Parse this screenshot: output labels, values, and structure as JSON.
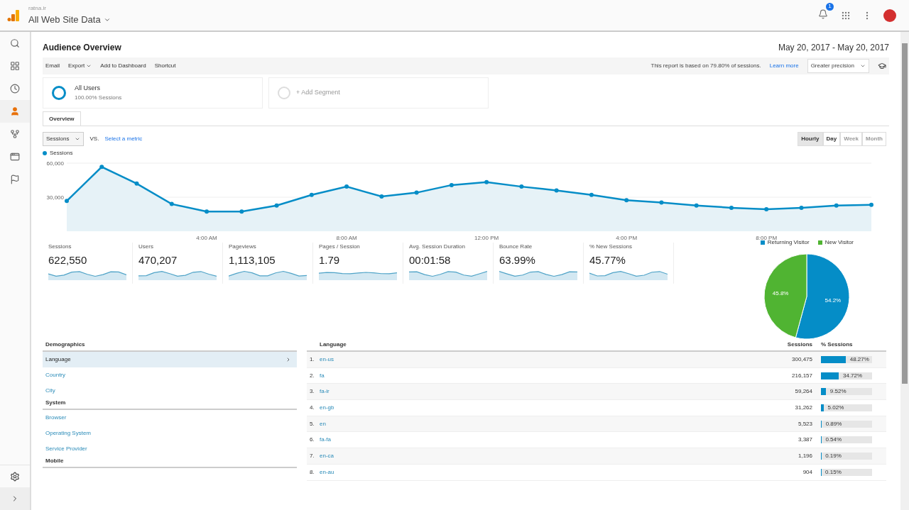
{
  "header": {
    "account": "ratna.ir",
    "property": "All Web Site Data",
    "notification_count": "1"
  },
  "sidebar": {
    "items": [
      {
        "kind": "search",
        "selected": false
      },
      {
        "kind": "dashboard",
        "selected": false
      },
      {
        "kind": "clock",
        "selected": false
      },
      {
        "kind": "person",
        "selected": true
      },
      {
        "kind": "fork",
        "selected": false
      },
      {
        "kind": "window",
        "selected": false
      },
      {
        "kind": "flag",
        "selected": false
      }
    ]
  },
  "page": {
    "title": "Audience Overview",
    "date_range": "May 20, 2017 - May 20, 2017"
  },
  "toolbar": {
    "actions": [
      {
        "label": "Email",
        "dropdown": false
      },
      {
        "label": "Export",
        "dropdown": true
      },
      {
        "label": "Add to Dashboard",
        "dropdown": false
      },
      {
        "label": "Shortcut",
        "dropdown": false
      }
    ],
    "notice": "This report is based on 79.80% of sessions.",
    "learn_more": "Learn more",
    "precision": "Greater precision"
  },
  "segments": [
    {
      "kind": "active",
      "name": "All Users",
      "detail": "100.00% Sessions"
    },
    {
      "kind": "add",
      "name": "+ Add Segment"
    }
  ],
  "tabs": [
    {
      "label": "Overview",
      "selected": true
    }
  ],
  "chart_controls": {
    "metric": "Sessions",
    "vs": "VS.",
    "select_metric": "Select a metric",
    "intervals": [
      {
        "label": "Hourly",
        "selected": true,
        "disabled": false
      },
      {
        "label": "Day",
        "selected": false,
        "disabled": false
      },
      {
        "label": "Week",
        "selected": false,
        "disabled": true
      },
      {
        "label": "Month",
        "selected": false,
        "disabled": true
      }
    ]
  },
  "line_chart": {
    "chart_data": {
      "type": "area",
      "x": [
        0,
        1,
        2,
        3,
        4,
        5,
        6,
        7,
        8,
        9,
        10,
        11,
        12,
        13,
        14,
        15,
        16,
        17,
        18,
        19,
        20,
        21,
        22,
        23
      ],
      "series": [
        {
          "name": "Sessions",
          "color": "#058dc7",
          "values": [
            26700,
            56700,
            42000,
            24000,
            17300,
            17300,
            22700,
            32000,
            39300,
            30700,
            34000,
            40700,
            43300,
            39300,
            36000,
            32000,
            27300,
            25300,
            22700,
            20700,
            19300,
            20700,
            22700,
            23300
          ]
        }
      ],
      "xlim": [
        0,
        23
      ],
      "ylim": [
        0,
        60000
      ],
      "yticks": [
        {
          "value": 30000,
          "label": "30,000"
        },
        {
          "value": 60000,
          "label": "60,000"
        }
      ],
      "xticks": [
        {
          "value": 4,
          "label": "4:00 AM"
        },
        {
          "value": 8,
          "label": "8:00 AM"
        },
        {
          "value": 12,
          "label": "12:00 PM"
        },
        {
          "value": 16,
          "label": "4:00 PM"
        },
        {
          "value": 20,
          "label": "8:00 PM"
        }
      ]
    }
  },
  "metrics": [
    {
      "label": "Sessions",
      "value": "622,550"
    },
    {
      "label": "Users",
      "value": "470,207"
    },
    {
      "label": "Pageviews",
      "value": "1,113,105"
    },
    {
      "label": "Pages / Session",
      "value": "1.79"
    },
    {
      "label": "Avg. Session Duration",
      "value": "00:01:58"
    },
    {
      "label": "Bounce Rate",
      "value": "63.99%"
    },
    {
      "label": "% New Sessions",
      "value": "45.77%"
    }
  ],
  "pie_chart": {
    "chart_data": {
      "type": "pie",
      "categories": [
        "Returning Visitor",
        "New Visitor"
      ],
      "values": [
        54.2,
        45.8
      ],
      "colors": [
        "#058dc7",
        "#50b432"
      ],
      "value_labels": [
        "54.2%",
        "45.8%"
      ],
      "legend": "top"
    }
  },
  "dimensions": {
    "groups": [
      {
        "title": "Demographics",
        "items": [
          {
            "label": "Language",
            "selected": true
          },
          {
            "label": "Country",
            "selected": false
          },
          {
            "label": "City",
            "selected": false
          }
        ]
      },
      {
        "title": "System",
        "items": [
          {
            "label": "Browser",
            "selected": false
          },
          {
            "label": "Operating System",
            "selected": false
          },
          {
            "label": "Service Provider",
            "selected": false
          }
        ]
      },
      {
        "title": "Mobile"
      }
    ]
  },
  "table": {
    "columns": [
      "Language",
      "Sessions",
      "% Sessions"
    ],
    "rows": [
      {
        "rank": "1.",
        "language": "en-us",
        "sessions": "300,475",
        "percent": "48.27%",
        "level": 0.4827
      },
      {
        "rank": "2.",
        "language": "fa",
        "sessions": "216,157",
        "percent": "34.72%",
        "level": 0.3472
      },
      {
        "rank": "3.",
        "language": "fa-ir",
        "sessions": "59,264",
        "percent": "9.52%",
        "level": 0.0952
      },
      {
        "rank": "4.",
        "language": "en-gb",
        "sessions": "31,262",
        "percent": "5.02%",
        "level": 0.0502
      },
      {
        "rank": "5.",
        "language": "en",
        "sessions": "5,523",
        "percent": "0.89%",
        "level": 0.0089
      },
      {
        "rank": "6.",
        "language": "fa-fa",
        "sessions": "3,387",
        "percent": "0.54%",
        "level": 0.0054
      },
      {
        "rank": "7.",
        "language": "en-ca",
        "sessions": "1,196",
        "percent": "0.19%",
        "level": 0.0019
      },
      {
        "rank": "8.",
        "language": "en-au",
        "sessions": "904",
        "percent": "0.15%",
        "level": 0.0015
      }
    ]
  }
}
